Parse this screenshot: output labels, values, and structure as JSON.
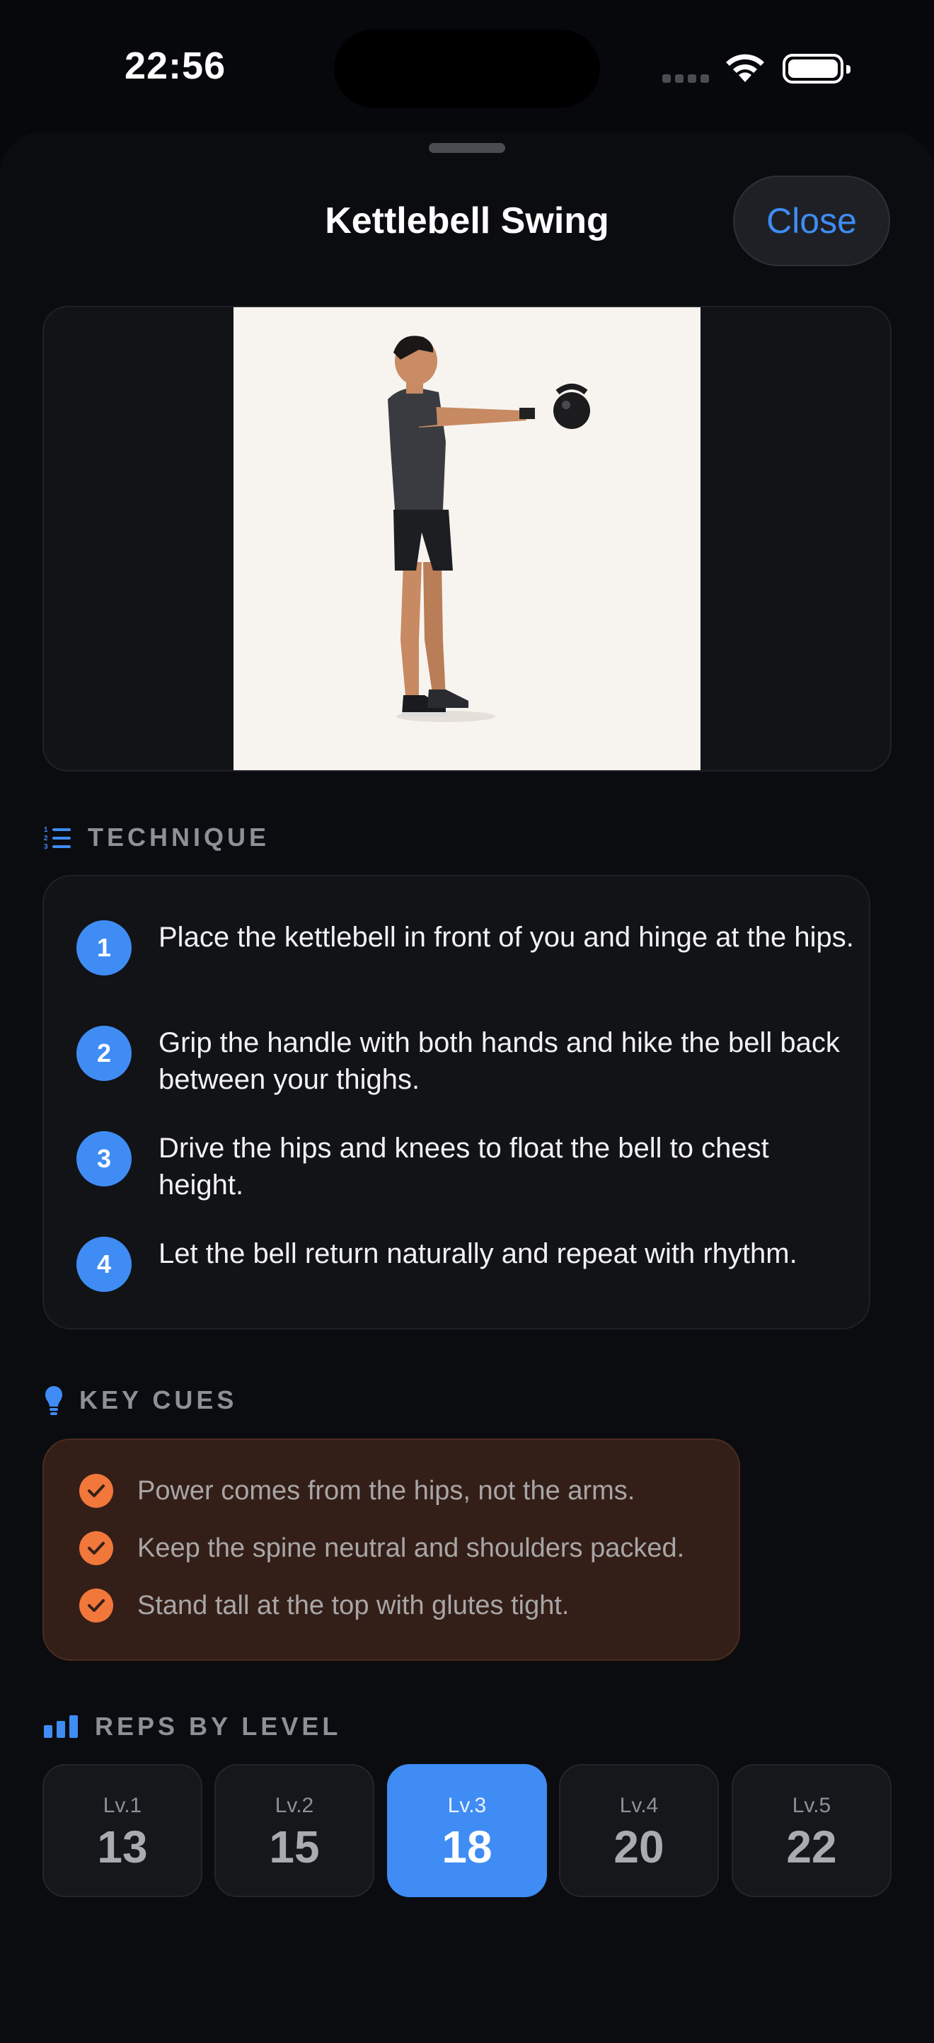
{
  "status": {
    "time": "22:56"
  },
  "header": {
    "title": "Kettlebell Swing",
    "close_label": "Close"
  },
  "technique": {
    "heading": "TECHNIQUE",
    "steps": [
      {
        "num": "1",
        "text": "Place the kettlebell in front of you and hinge at the hips."
      },
      {
        "num": "2",
        "text": "Grip the handle with both hands and hike the bell back between your thighs."
      },
      {
        "num": "3",
        "text": "Drive the hips and knees to float the bell to chest height."
      },
      {
        "num": "4",
        "text": "Let the bell return naturally and repeat with rhythm."
      }
    ]
  },
  "cues": {
    "heading": "KEY CUES",
    "items": [
      "Power comes from the hips, not the arms.",
      "Keep the spine neutral and shoulders packed.",
      "Stand tall at the top with glutes tight."
    ]
  },
  "reps": {
    "heading": "REPS BY LEVEL",
    "selected_level": "Lv.3",
    "levels": [
      {
        "label": "Lv.1",
        "value": "13"
      },
      {
        "label": "Lv.2",
        "value": "15"
      },
      {
        "label": "Lv.3",
        "value": "18"
      },
      {
        "label": "Lv.4",
        "value": "20"
      },
      {
        "label": "Lv.5",
        "value": "22"
      }
    ]
  },
  "colors": {
    "accent": "#3f8cf4",
    "cue_accent": "#f2773a",
    "background": "#0b0c10"
  },
  "icons": {
    "technique": "numbered-list-icon",
    "cues": "lightbulb-icon",
    "reps": "bar-chart-icon",
    "cue_item": "check-circle-icon"
  }
}
